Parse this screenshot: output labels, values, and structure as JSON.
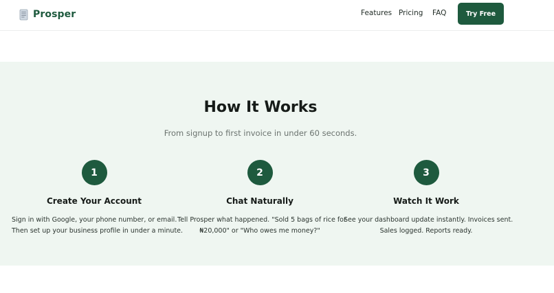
{
  "nav": {
    "brand": "Prosper",
    "logo_icon": "document-icon",
    "links": [
      "Features",
      "Pricing",
      "FAQ"
    ],
    "cta_label": "Try Free"
  },
  "how_it_works": {
    "title": "How It Works",
    "subtitle": "From signup to first invoice in under 60 seconds.",
    "steps": [
      {
        "number": "1",
        "title": "Create Your Account",
        "description_lines": [
          "Sign in with Google, your phone number, or email.",
          "Then set up your business profile in under a minute."
        ]
      },
      {
        "number": "2",
        "title": "Chat Naturally",
        "description_lines": [
          "Tell Prosper what happened. \"Sold 5 bags of rice for",
          "₦20,000\" or \"Who owes me money?\""
        ]
      },
      {
        "number": "3",
        "title": "Watch It Work",
        "description_lines": [
          "See your dashboard update instantly. Invoices sent.",
          "Sales logged. Reports ready."
        ]
      }
    ]
  },
  "colors": {
    "brand_green": "#1e5a3e",
    "section_background": "#eff6f1",
    "page_background": "#ffffff"
  }
}
